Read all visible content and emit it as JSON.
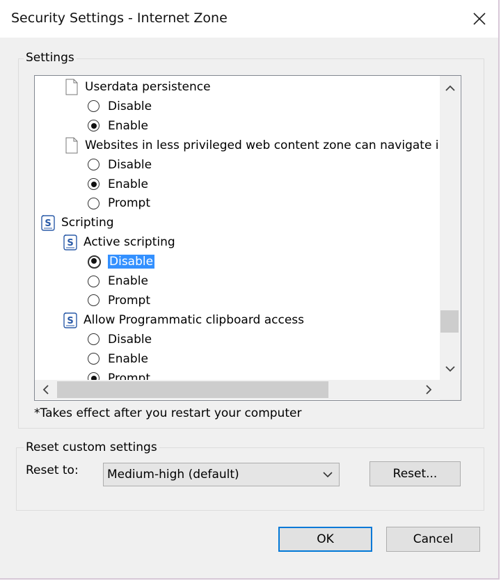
{
  "window": {
    "title": "Security Settings - Internet Zone",
    "close_label": "✕"
  },
  "settings_group": {
    "label": "Settings",
    "tree": [
      {
        "kind": "doc",
        "label": "Userdata persistence"
      },
      {
        "kind": "radio",
        "label": "Disable",
        "checked": false
      },
      {
        "kind": "radio",
        "label": "Enable",
        "checked": true
      },
      {
        "kind": "doc",
        "label": "Websites in less privileged web content zone can navigate in"
      },
      {
        "kind": "radio",
        "label": "Disable",
        "checked": false
      },
      {
        "kind": "radio",
        "label": "Enable",
        "checked": true
      },
      {
        "kind": "radio",
        "label": "Prompt",
        "checked": false
      },
      {
        "kind": "script-category",
        "label": "Scripting"
      },
      {
        "kind": "script",
        "label": "Active scripting"
      },
      {
        "kind": "radio",
        "label": "Disable",
        "checked": true,
        "selected": true
      },
      {
        "kind": "radio",
        "label": "Enable",
        "checked": false
      },
      {
        "kind": "radio",
        "label": "Prompt",
        "checked": false
      },
      {
        "kind": "script",
        "label": "Allow Programmatic clipboard access"
      },
      {
        "kind": "radio",
        "label": "Disable",
        "checked": false
      },
      {
        "kind": "radio",
        "label": "Enable",
        "checked": false
      },
      {
        "kind": "radio",
        "label": "Prompt",
        "checked": true
      }
    ],
    "note": "*Takes effect after you restart your computer"
  },
  "reset_group": {
    "label": "Reset custom settings",
    "reset_to_label": "Reset to:",
    "selected_level": "Medium-high (default)",
    "reset_button": "Reset..."
  },
  "footer": {
    "ok": "OK",
    "cancel": "Cancel"
  },
  "colors": {
    "selection": "#3390ff",
    "default_button_border": "#0078d7",
    "script_icon": "#2b5ba8"
  },
  "icons": {
    "doc": "document-icon",
    "script": "script-icon"
  }
}
